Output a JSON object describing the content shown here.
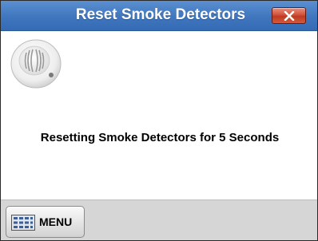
{
  "window": {
    "title": "Reset Smoke Detectors",
    "close_label": "x"
  },
  "detector_image": {
    "icon": "smoke-detector-icon"
  },
  "status": {
    "message": "Resetting Smoke Detectors for 5 Seconds"
  },
  "bottom_bar": {
    "menu_button": {
      "label": "MENU",
      "icon": "menu-grid-icon"
    }
  },
  "colors": {
    "titlebar": "#3f76be",
    "close_button": "#d2523c",
    "bottom_bar": "#d6d6d6"
  }
}
